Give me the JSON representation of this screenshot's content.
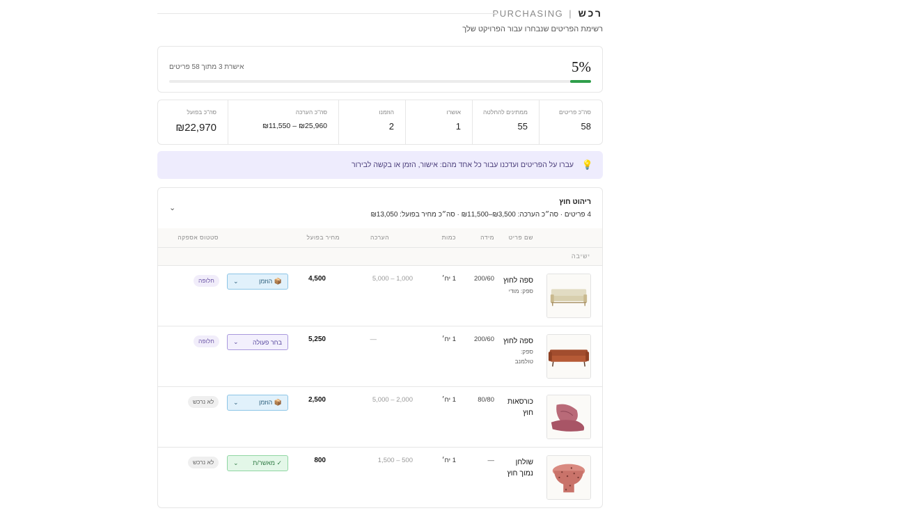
{
  "header": {
    "title_he": "רכש",
    "separator": "|",
    "title_en": "PURCHASING",
    "subtitle": "רשימת הפריטים שנבחרו עבור הפרויקט שלך"
  },
  "progress": {
    "percent_label": "5%",
    "percent_value": 5,
    "approved_text": "אישרת 3 מתוך 58 פריטים",
    "bar_color": "#2e9e4a"
  },
  "stats": [
    {
      "label": "סה\"כ פריטים",
      "value": "58"
    },
    {
      "label": "ממתינים להחלטה",
      "value": "55"
    },
    {
      "label": "אושרו",
      "value": "1"
    },
    {
      "label": "הוזמנו",
      "value": "2"
    },
    {
      "label": "סה\"כ הערכה",
      "value": "₪25,960 – ₪11,550"
    },
    {
      "label": "סה\"כ בפועל",
      "value": "₪22,970"
    }
  ],
  "hint": {
    "icon": "lightbulb-icon",
    "text": "עברו על הפריטים ועדכנו עבור כל אחד מהם: אישור, הזמן או בקשה לבירור"
  },
  "group": {
    "title": "ריהוט חוץ",
    "summary": "4 פריטים · סה״כ הערכה: ₪3,500–₪11,500 · סה״כ מחיר בפועל: ₪13,050",
    "columns": {
      "name": "שם פריט",
      "size": "מידה",
      "qty": "כמות",
      "estimate": "הערכה",
      "actual": "מחיר בפועל",
      "status": "סטטוס אספקה"
    },
    "section": "ישיבה",
    "rows": [
      {
        "name": "ספה לחוץ",
        "supplier": "ספק: מודי",
        "size": "200/60",
        "qty": "1 יח׳",
        "estimate": "1,000 – 5,000",
        "actual": "4,500",
        "action": "הוזמן",
        "action_icon": "package-icon",
        "action_style": "ordered",
        "badge": "חלופה",
        "badge_style": "alt",
        "image": "outdoor-sofa-beige"
      },
      {
        "name": "ספה לחוץ",
        "supplier": "ספק: טולמנב",
        "size": "200/60",
        "qty": "1 יח׳",
        "estimate": "—",
        "actual": "5,250",
        "action": "בחר פעולה",
        "action_icon": "",
        "action_style": "choose",
        "badge": "חלופה",
        "badge_style": "alt",
        "image": "outdoor-sofa-rust"
      },
      {
        "name": "כורסאות חוץ",
        "supplier": "",
        "size": "80/80",
        "qty": "1 יח׳",
        "estimate": "2,000 – 5,000",
        "actual": "2,500",
        "action": "הוזמן",
        "action_icon": "package-icon",
        "action_style": "ordered",
        "badge": "לא נרכש",
        "badge_style": "no",
        "image": "floor-chair-pink"
      },
      {
        "name": "שולחן נמוך חוץ",
        "supplier": "",
        "size": "—",
        "qty": "1 יח׳",
        "estimate": "500 – 1,500",
        "actual": "800",
        "action": "מאשר/ת",
        "action_icon": "check-icon",
        "action_style": "approved",
        "badge": "לא נרכש",
        "badge_style": "no",
        "image": "low-table-terrazzo"
      }
    ]
  }
}
